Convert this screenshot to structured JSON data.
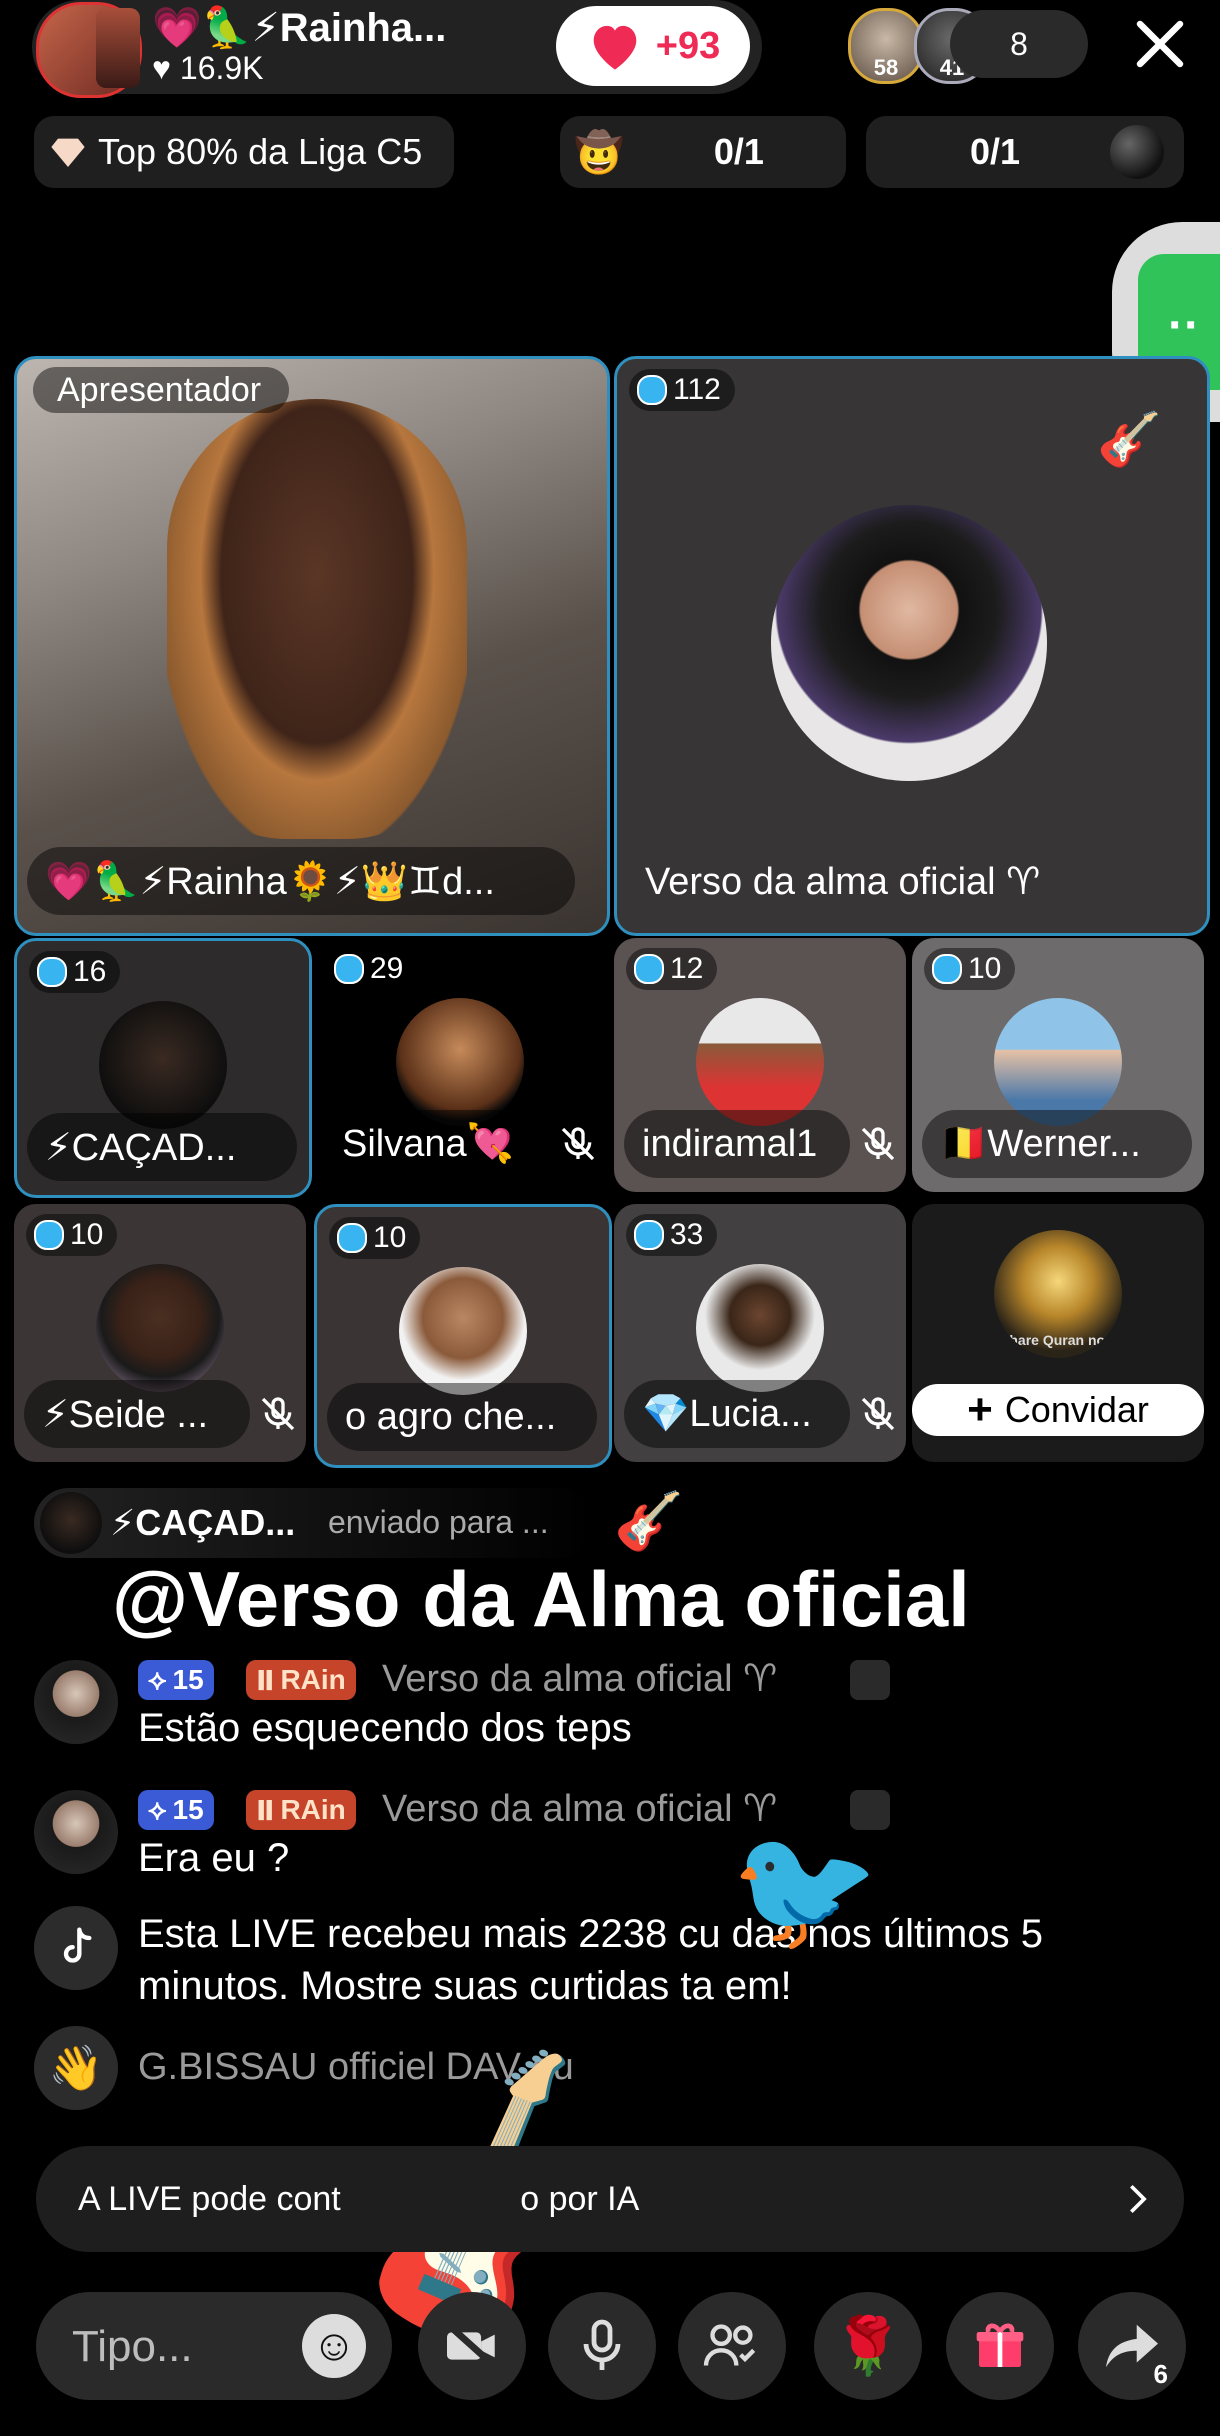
{
  "header": {
    "host_name": "💗🦜⚡Rainha...",
    "host_likes": "16.9K",
    "like_count": "+93",
    "viewer_badges": [
      "58",
      "41"
    ],
    "viewer_count": "8"
  },
  "chips": {
    "league": "Top 80% da Liga C5",
    "goal1_progress": "0/1",
    "goal2_progress": "0/1"
  },
  "tiles": {
    "host_label": "Apresentador",
    "host_name": "💗🦜⚡Rainha🌻⚡👑♊d...",
    "guest_main_badge": "112",
    "guest_main_name": "Verso da alma oficial ♈",
    "grid": [
      {
        "badge": "16",
        "name": "⚡CAÇAD..."
      },
      {
        "badge": "29",
        "name": "Silvana💘"
      },
      {
        "badge": "12",
        "name": "indiramal1"
      },
      {
        "badge": "10",
        "name": "🇧🇪Werner..."
      },
      {
        "badge": "10",
        "name": "⚡Seide ..."
      },
      {
        "badge": "10",
        "name": "o agro che..."
      },
      {
        "badge": "33",
        "name": "💎Lucia..."
      }
    ],
    "invite_label": "Convidar",
    "invite_caption": "Share Quran now"
  },
  "gift_notice": {
    "sender": "⚡CAÇAD...",
    "text": "enviado para ...",
    "target": "@Verso da Alma oficial"
  },
  "chat": [
    {
      "level": "15",
      "fan_badge": "RAin",
      "name": "Verso da alma oficial ♈",
      "text": "Estão esquecendo dos teps"
    },
    {
      "level": "15",
      "fan_badge": "RAin",
      "name": "Verso da alma oficial ♈",
      "text": "Era eu ?"
    }
  ],
  "system": {
    "live_likes": "Esta LIVE recebeu mais 2238 cu    das nos últimos 5 minutos. Mostre suas curtidas ta    em!",
    "joined": "G.BISSAU officiel DAV          ou"
  },
  "ai_banner": "A LIVE pode cont                   o por IA",
  "input": {
    "placeholder": "Tipo..."
  },
  "share_count": "6",
  "colors": {
    "accent": "#ee2a55",
    "tile_border": "#2f8fbe",
    "level_badge": "#3b5bd6",
    "fan_badge": "#c6452a"
  }
}
